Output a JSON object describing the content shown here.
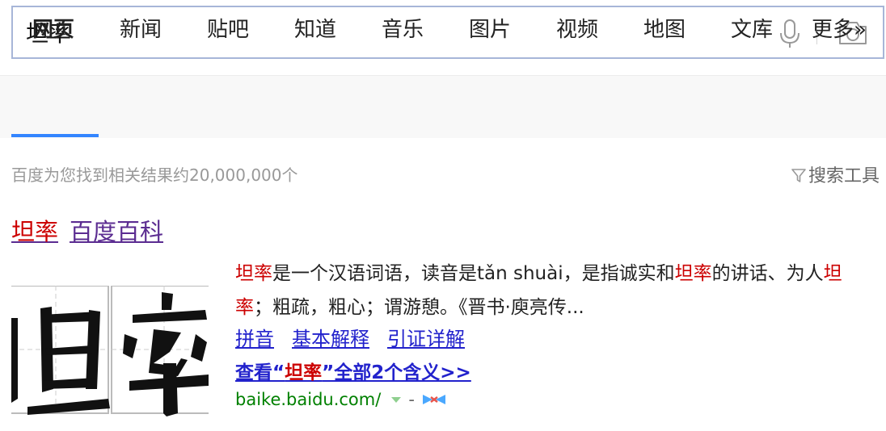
{
  "search": {
    "value": "坦率"
  },
  "tabs": [
    {
      "label": "网页",
      "active": true
    },
    {
      "label": "新闻"
    },
    {
      "label": "贴吧"
    },
    {
      "label": "知道"
    },
    {
      "label": "音乐"
    },
    {
      "label": "图片"
    },
    {
      "label": "视频"
    },
    {
      "label": "地图"
    },
    {
      "label": "文库"
    },
    {
      "label": "更多»"
    }
  ],
  "result_count": "百度为您找到相关结果约20,000,000个",
  "search_tools_label": "搜索工具",
  "result": {
    "title_keyword": "坦率",
    "title_rest": "百度百科",
    "abstract": {
      "p1_hl": "坦率",
      "p1_text": "是一个汉语词语，读音是tǎn shuài，是指诚实和",
      "p2_hl": "坦率",
      "p2_text": "的讲话、为人",
      "p3_hl": "坦率",
      "p3_text": "；粗疏，粗心；谓游憩。《晋书·庾亮传..."
    },
    "links": [
      "拼音",
      "基本解释",
      "引证详解"
    ],
    "view_all": {
      "prefix": "查看“",
      "keyword": "坦率",
      "suffix": "”全部2个含义>>"
    },
    "source_url": "baike.baidu.com/",
    "source_dash": "-"
  },
  "colors": {
    "accent": "#3385ff",
    "highlight": "#c00000",
    "link": "#2222cc",
    "visited": "#5b2c91",
    "url": "#008000"
  },
  "icons": [
    "mic-icon",
    "camera-icon",
    "filter-icon",
    "dropdown-arrow-icon",
    "baike-logo-icon"
  ]
}
